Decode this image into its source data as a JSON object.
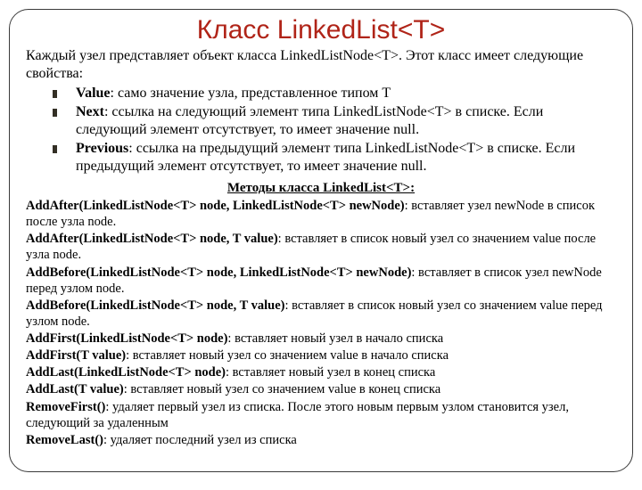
{
  "title": "Класс LinkedList<T>",
  "intro": "Каждый узел представляет объект класса LinkedListNode<T>. Этот класс имеет следующие свойства:",
  "properties": [
    {
      "name": "Value",
      "desc": ": само значение узла, представленное типом T"
    },
    {
      "name": "Next",
      "desc": ": ссылка на следующий элемент типа LinkedListNode<T> в списке. Если следующий элемент отсутствует, то имеет значение null."
    },
    {
      "name": "Previous",
      "desc": ": ссылка на предыдущий элемент типа LinkedListNode<T> в списке. Если предыдущий элемент отсутствует, то имеет значение null."
    }
  ],
  "methods_heading": "Методы класса LinkedList<T>:",
  "methods": [
    {
      "sig": "AddAfter(LinkedListNode<T> node, LinkedListNode<T> newNode)",
      "desc": ": вставляет узел newNode в список после узла node."
    },
    {
      "sig": "AddAfter(LinkedListNode<T> node, T value)",
      "desc": ": вставляет в список новый узел со значением value после узла node."
    },
    {
      "sig": "AddBefore(LinkedListNode<T> node, LinkedListNode<T> newNode)",
      "desc": ": вставляет в список узел newNode перед узлом node."
    },
    {
      "sig": "AddBefore(LinkedListNode<T> node, T value)",
      "desc": ": вставляет в список новый узел со значением value перед узлом node."
    },
    {
      "sig": "AddFirst(LinkedListNode<T> node)",
      "desc": ": вставляет новый узел в начало списка"
    },
    {
      "sig": "AddFirst(T value)",
      "desc": ": вставляет новый узел со значением value в начало списка"
    },
    {
      "sig": "AddLast(LinkedListNode<T> node)",
      "desc": ": вставляет новый узел в конец списка"
    },
    {
      "sig": "AddLast(T value)",
      "desc": ": вставляет новый узел со значением value в конец списка"
    },
    {
      "sig": "RemoveFirst()",
      "desc": ": удаляет первый узел из списка. После этого новым первым узлом становится узел, следующий за удаленным"
    },
    {
      "sig": "RemoveLast()",
      "desc": ": удаляет последний узел из списка"
    }
  ]
}
